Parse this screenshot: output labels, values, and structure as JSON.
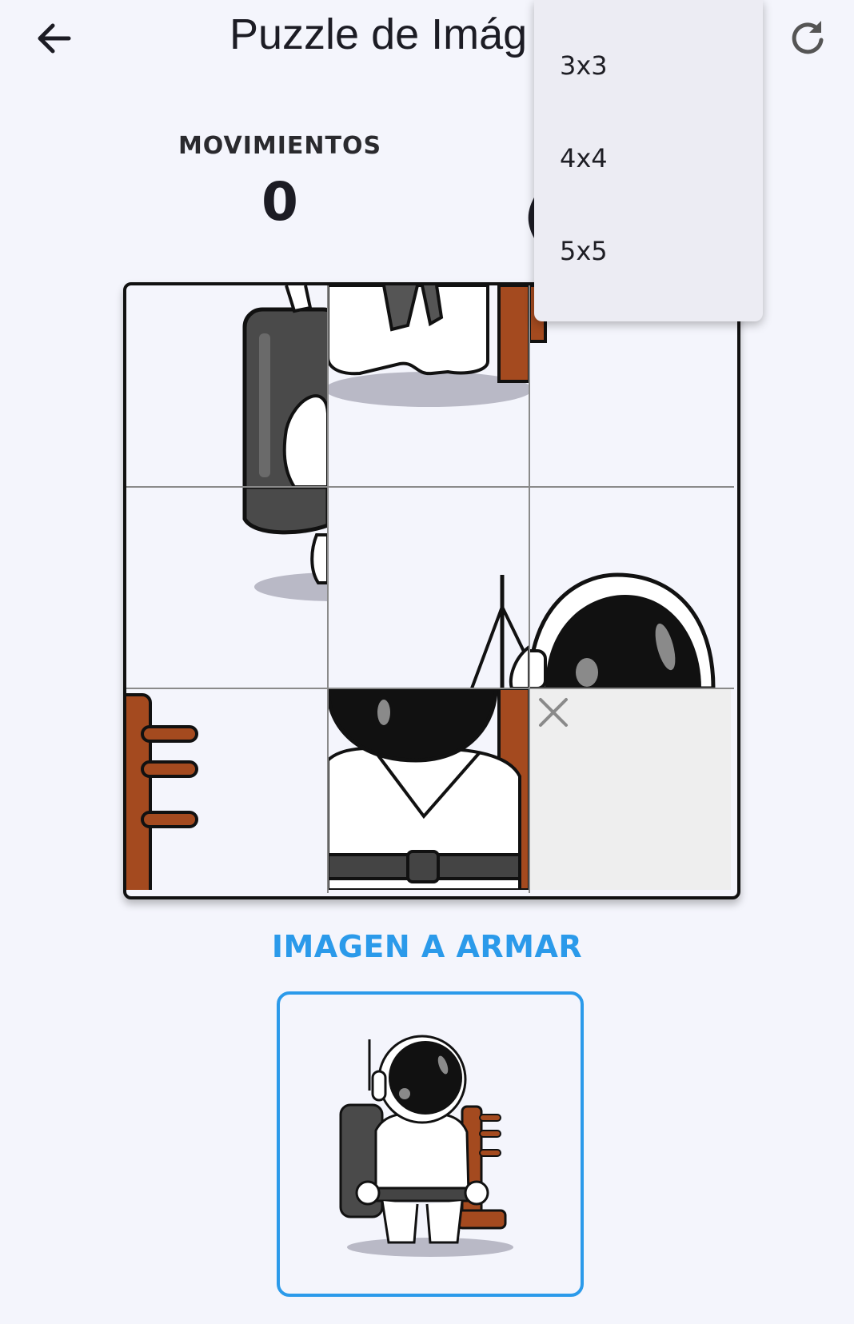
{
  "appbar": {
    "title": "Puzzle de Imág",
    "back_icon": "arrow-left-icon",
    "refresh_icon": "refresh-icon"
  },
  "stats": {
    "moves_label": "MOVIMIENTOS",
    "moves_value": "0",
    "second_value_partial": "("
  },
  "grid_menu": {
    "options": [
      "3x3",
      "4x4",
      "5x5"
    ]
  },
  "board": {
    "size": "3x3",
    "empty_tile_icon": "close-icon"
  },
  "target": {
    "label": "IMAGEN A ARMAR"
  },
  "colors": {
    "accent": "#2b9aea",
    "background": "#f4f5fc",
    "menu_bg": "#ececf3",
    "empty_tile": "#eeeeee"
  }
}
